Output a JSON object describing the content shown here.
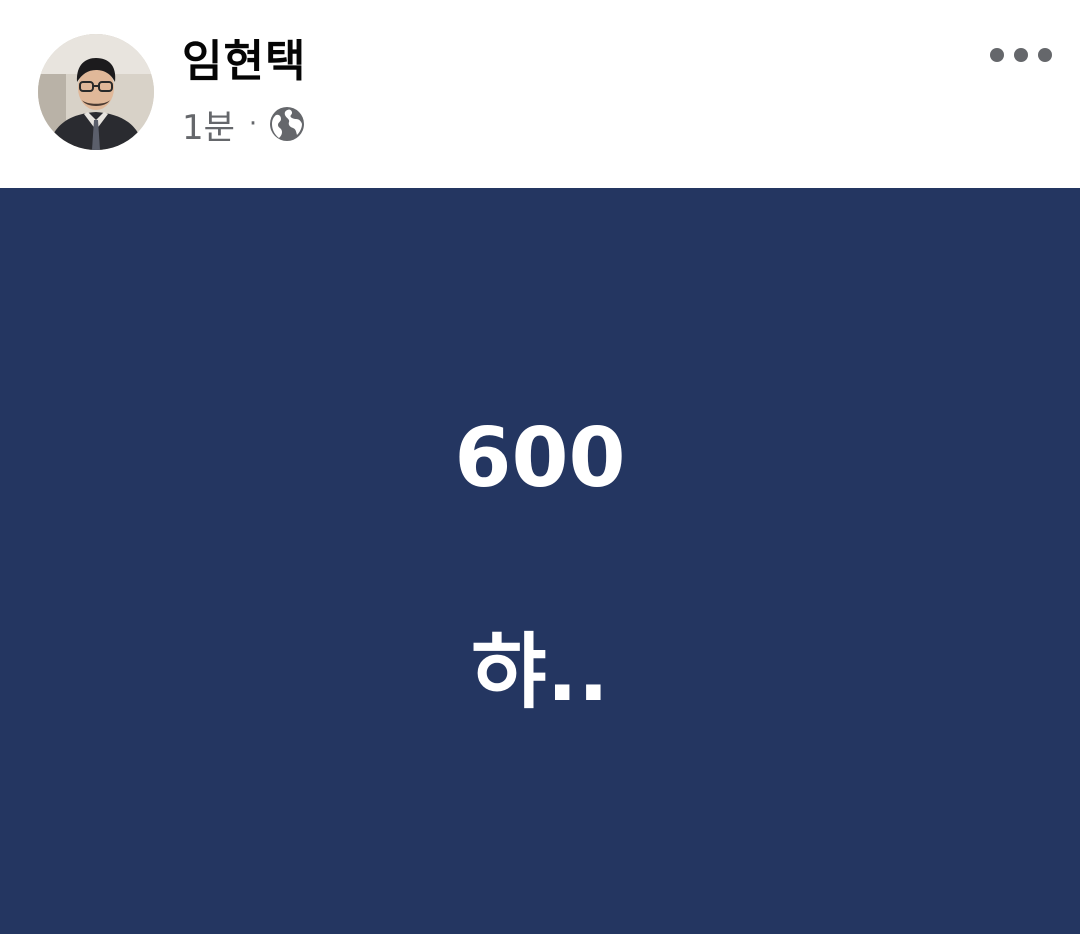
{
  "post": {
    "author": {
      "name": "임현택",
      "avatar_icon": "profile-photo"
    },
    "meta": {
      "time": "1분",
      "separator": "·",
      "privacy_icon": "globe-icon"
    },
    "more_icon": "more-options-icon",
    "body": {
      "background_color": "#243661",
      "text_color": "#ffffff",
      "line1": "600",
      "line2": "햐.."
    }
  }
}
